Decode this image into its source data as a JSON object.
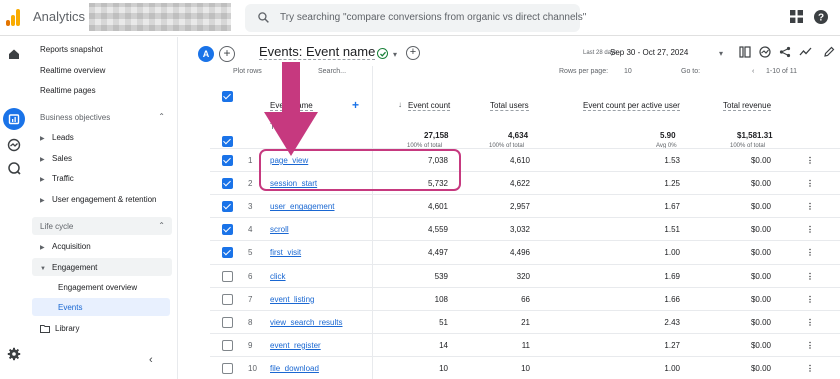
{
  "app": {
    "title": "Analytics"
  },
  "search": {
    "placeholder": "Try searching \"compare conversions from organic vs direct channels\""
  },
  "colors": {
    "accent": "#1a73e8",
    "link": "#1967d2",
    "highlight": "#c6397f",
    "logo_orange": "#f9ab00",
    "logo_dark": "#e37400",
    "check_green": "#188038"
  },
  "icons": {
    "topbar": [
      "search-icon",
      "apps-grid-icon",
      "help-icon"
    ],
    "rail": [
      "home-icon",
      "reports-icon",
      "explore-icon",
      "advertising-icon",
      "settings-icon"
    ],
    "header": [
      "compare-icon",
      "insights-icon",
      "share-icon",
      "trend-icon",
      "edit-icon"
    ]
  },
  "nav": {
    "items": [
      {
        "label": "Reports snapshot"
      },
      {
        "label": "Realtime overview"
      },
      {
        "label": "Realtime pages"
      }
    ],
    "business_objectives": {
      "heading": "Business objectives",
      "items": [
        {
          "label": "Leads"
        },
        {
          "label": "Sales"
        },
        {
          "label": "Traffic"
        },
        {
          "label": "User engagement & retention"
        }
      ]
    },
    "life_cycle": {
      "heading": "Life cycle",
      "items": [
        {
          "label": "Acquisition"
        },
        {
          "label": "Engagement"
        },
        {
          "label": "Engagement overview"
        },
        {
          "label": "Events"
        }
      ]
    },
    "library": {
      "label": "Library"
    }
  },
  "header": {
    "avatar_letter": "A",
    "title": "Events: Event name",
    "date_prefix": "Last 28 days",
    "date_range": "Sep 30 - Oct 27, 2024"
  },
  "table": {
    "toolbar": {
      "plot_rows": "Plot rows",
      "search": "Search...",
      "rows_per_page": "Rows per page:",
      "rows_value": "10",
      "goto": "Go to:",
      "pagination": "1-10 of 11"
    },
    "columns": {
      "event_name": "Event name",
      "event_count": "Event count",
      "total_users": "Total users",
      "per_user": "Event count per active user",
      "revenue": "Total revenue"
    },
    "totals": {
      "label": "Total",
      "event_count": "27,158",
      "event_count_sub": "100% of total",
      "total_users": "4,634",
      "total_users_sub": "100% of total",
      "per_user": "5.90",
      "per_user_sub": "Avg 0%",
      "revenue": "$1,581.31",
      "revenue_sub": "100% of total"
    },
    "rows": [
      {
        "num": "1",
        "checked": true,
        "name": "page_view",
        "count": "7,038",
        "users": "4,610",
        "per_user": "1.53",
        "revenue": "$0.00",
        "menu": "⋮"
      },
      {
        "num": "2",
        "checked": true,
        "name": "session_start",
        "count": "5,732",
        "users": "4,622",
        "per_user": "1.25",
        "revenue": "$0.00",
        "menu": "⋮"
      },
      {
        "num": "3",
        "checked": true,
        "name": "user_engagement",
        "count": "4,601",
        "users": "2,957",
        "per_user": "1.67",
        "revenue": "$0.00",
        "menu": "⋮"
      },
      {
        "num": "4",
        "checked": true,
        "name": "scroll",
        "count": "4,559",
        "users": "3,032",
        "per_user": "1.51",
        "revenue": "$0.00",
        "menu": "⋮"
      },
      {
        "num": "5",
        "checked": true,
        "name": "first_visit",
        "count": "4,497",
        "users": "4,496",
        "per_user": "1.00",
        "revenue": "$0.00",
        "menu": "⋮"
      },
      {
        "num": "6",
        "checked": false,
        "name": "click",
        "count": "539",
        "users": "320",
        "per_user": "1.69",
        "revenue": "$0.00",
        "menu": "⋮"
      },
      {
        "num": "7",
        "checked": false,
        "name": "event_listing",
        "count": "108",
        "users": "66",
        "per_user": "1.66",
        "revenue": "$0.00",
        "menu": "⋮"
      },
      {
        "num": "8",
        "checked": false,
        "name": "view_search_results",
        "count": "51",
        "users": "21",
        "per_user": "2.43",
        "revenue": "$0.00",
        "menu": "⋮"
      },
      {
        "num": "9",
        "checked": false,
        "name": "event_register",
        "count": "14",
        "users": "11",
        "per_user": "1.27",
        "revenue": "$0.00",
        "menu": "⋮"
      },
      {
        "num": "10",
        "checked": false,
        "name": "file_download",
        "count": "10",
        "users": "10",
        "per_user": "1.00",
        "revenue": "$0.00",
        "menu": "⋮"
      }
    ]
  }
}
